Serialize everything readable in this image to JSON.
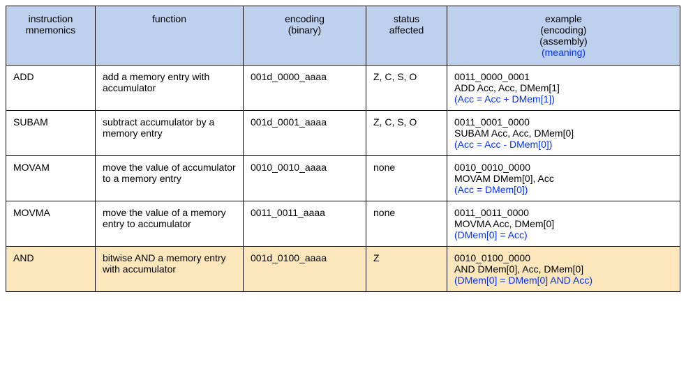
{
  "headers": {
    "mnemonics": "instruction\nmnemonics",
    "function": "function",
    "encoding": "encoding\n(binary)",
    "status": "status\naffected",
    "example_l1": "example",
    "example_l2": "(encoding)",
    "example_l3": "(assembly)",
    "example_l4": "(meaning)"
  },
  "rows": [
    {
      "mnemonic": "ADD",
      "function": "add a memory entry with accumulator",
      "encoding": "001d_0000_aaaa",
      "status": "Z, C, S, O",
      "ex_enc": "0011_0000_0001",
      "ex_asm": "ADD Acc, Acc, DMem[1]",
      "ex_meaning": "(Acc = Acc + DMem[1])",
      "hl": false
    },
    {
      "mnemonic": "SUBAM",
      "function": "subtract accumulator by a memory entry",
      "encoding": "001d_0001_aaaa",
      "status": "Z, C, S, O",
      "ex_enc": "0011_0001_0000",
      "ex_asm": "SUBAM Acc, Acc, DMem[0]",
      "ex_meaning": "(Acc = Acc - DMem[0])",
      "hl": false
    },
    {
      "mnemonic": "MOVAM",
      "function": "move the value of accumulator to a memory entry",
      "encoding": "0010_0010_aaaa",
      "status": "none",
      "ex_enc": "0010_0010_0000",
      "ex_asm": "MOVAM DMem[0], Acc",
      "ex_meaning": "(Acc = DMem[0])",
      "hl": false
    },
    {
      "mnemonic": "MOVMA",
      "function": "move the value of a memory entry to accumulator",
      "encoding": "0011_0011_aaaa",
      "status": "none",
      "ex_enc": "0011_0011_0000",
      "ex_asm": "MOVMA Acc, DMem[0]",
      "ex_meaning": "(DMem[0] = Acc)",
      "hl": false
    },
    {
      "mnemonic": "AND",
      "function": "bitwise AND a memory entry with accumulator",
      "encoding": "001d_0100_aaaa",
      "status": "Z",
      "ex_enc": "0010_0100_0000",
      "ex_asm": "AND DMem[0], Acc, DMem[0]",
      "ex_meaning": "(DMem[0] = DMem[0] AND Acc)",
      "hl": true
    }
  ]
}
